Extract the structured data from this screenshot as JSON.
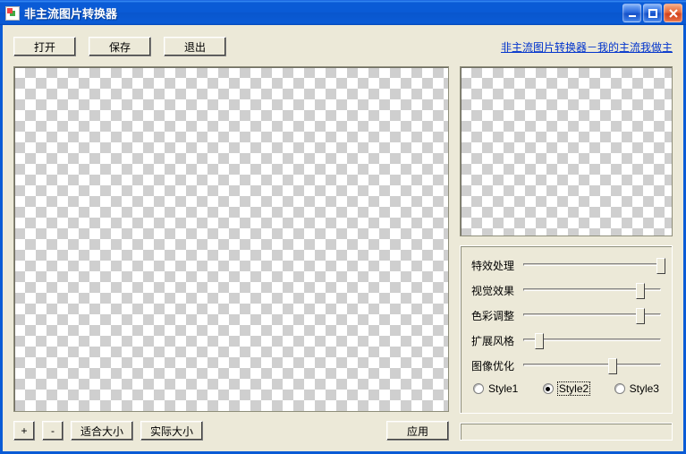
{
  "window": {
    "title": "非主流图片转换器"
  },
  "toolbar": {
    "open": "打开",
    "save": "保存",
    "exit": "退出",
    "link": "非主流图片转换器－我的主流我做主"
  },
  "bottom": {
    "zoom_in": "+",
    "zoom_out": "-",
    "fit": "适合大小",
    "actual": "实际大小",
    "apply": "应用"
  },
  "sliders": {
    "fx": {
      "label": "特效处理",
      "value": 100
    },
    "visual": {
      "label": "视觉效果",
      "value": 85
    },
    "color": {
      "label": "色彩调整",
      "value": 85
    },
    "style": {
      "label": "扩展风格",
      "value": 12
    },
    "optimize": {
      "label": "图像优化",
      "value": 65
    }
  },
  "radios": {
    "opt1": "Style1",
    "opt2": "Style2",
    "opt3": "Style3",
    "selected": "opt2"
  }
}
